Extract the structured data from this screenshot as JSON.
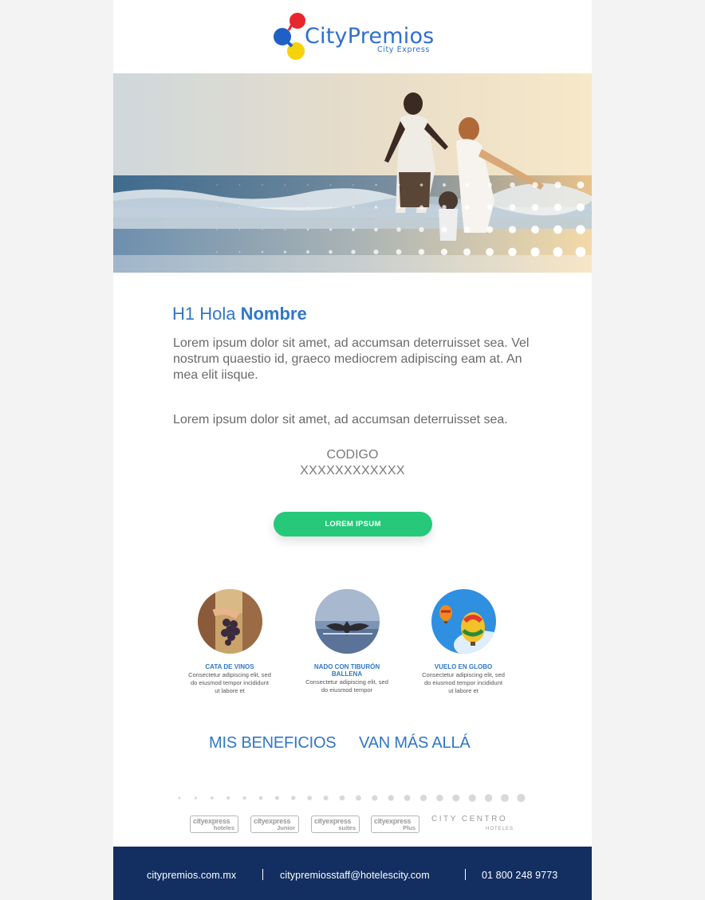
{
  "brand": {
    "name": "CityPremios",
    "tagline": "City Express"
  },
  "greeting": {
    "prefix": "H1 Hola",
    "name": "Nombre"
  },
  "body": {
    "paragraph_1": "Lorem ipsum dolor sit amet, ad accumsan deterruisset sea. Vel nostrum quaestio id, graeco mediocrem adipiscing eam at. An mea elit iisque.",
    "paragraph_2": "Lorem ipsum dolor sit amet, ad accumsan deterruisset sea."
  },
  "code": {
    "label": "CODIGO",
    "value": "XXXXXXXXXXXX"
  },
  "cta": {
    "label": "LOREM IPSUM",
    "color": "#26c97a"
  },
  "experiences": [
    {
      "title": "CATA DE VINOS",
      "description": "Consectetur adipiscing elit, sed do eiusmod tempor incididunt ut labore et",
      "icon": "grapes-image"
    },
    {
      "title": "NADO CON TIBURÓN BALLENA",
      "description": "Consectetur adipiscing elit, sed do eiusmod tempor",
      "icon": "whale-tail-image"
    },
    {
      "title": "VUELO EN GLOBO",
      "description": "Consectetur adipiscing elit, sed do eiusmod tempor incididunt ut labore et",
      "icon": "hot-air-balloon-image"
    }
  ],
  "tagline": {
    "part_1": "MIS BENEFICIOS",
    "part_2": "VAN MÁS ALLÁ"
  },
  "hotel_brands": [
    {
      "name": "cityexpress",
      "sub": "hoteles"
    },
    {
      "name": "cityexpress",
      "sub": "Junior"
    },
    {
      "name": "cityexpress",
      "sub": "suites"
    },
    {
      "name": "cityexpress",
      "sub": "Plus"
    }
  ],
  "centro": {
    "name": "CITY CENTRO",
    "sub": "HOTELES"
  },
  "footer": {
    "website": "citypremios.com.mx",
    "email": "citypremiosstaff@hotelescity.com",
    "phone": "01 800 248 9773",
    "background": "#132f62"
  },
  "colors": {
    "accent_blue": "#2f77c8",
    "logo_red": "#e8262d",
    "logo_blue": "#1f5fc6",
    "logo_yellow": "#f5d20a"
  }
}
